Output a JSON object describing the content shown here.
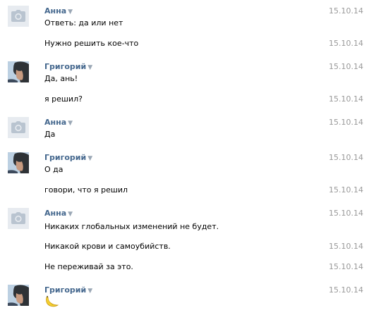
{
  "groups": [
    {
      "sender": "Анна",
      "avatar": "camera-placeholder",
      "messages": [
        {
          "text": "Ответь: да или нет",
          "date": "15.10.14"
        },
        {
          "text": "Нужно решить кое-что",
          "date": "15.10.14"
        }
      ]
    },
    {
      "sender": "Григорий",
      "avatar": "user-photo",
      "messages": [
        {
          "text": "Да, ань!",
          "date": "15.10.14"
        },
        {
          "text": "я решил?",
          "date": "15.10.14"
        }
      ]
    },
    {
      "sender": "Анна",
      "avatar": "camera-placeholder",
      "messages": [
        {
          "text": "Да",
          "date": "15.10.14"
        }
      ]
    },
    {
      "sender": "Григорий",
      "avatar": "user-photo",
      "messages": [
        {
          "text": "О да",
          "date": "15.10.14"
        },
        {
          "text": "говори, что я решил",
          "date": "15.10.14"
        }
      ]
    },
    {
      "sender": "Анна",
      "avatar": "camera-placeholder",
      "messages": [
        {
          "text": "Никаких глобальных изменений не будет.",
          "date": "15.10.14"
        },
        {
          "text": "Никакой крови и самоубийств.",
          "date": "15.10.14"
        },
        {
          "text": "Не переживай за это.",
          "date": "15.10.14"
        }
      ]
    },
    {
      "sender": "Григорий",
      "avatar": "user-photo",
      "messages": [
        {
          "emoji": "banana-emoji",
          "date": "15.10.14"
        }
      ]
    }
  ],
  "sender_menu_glyph": "▼",
  "colors": {
    "sender_name": "#45688e",
    "date": "#999999",
    "avatar_placeholder_bg": "#e7ebf0",
    "avatar_placeholder_icon": "#b9c4d0",
    "banana": "#f5d033"
  }
}
